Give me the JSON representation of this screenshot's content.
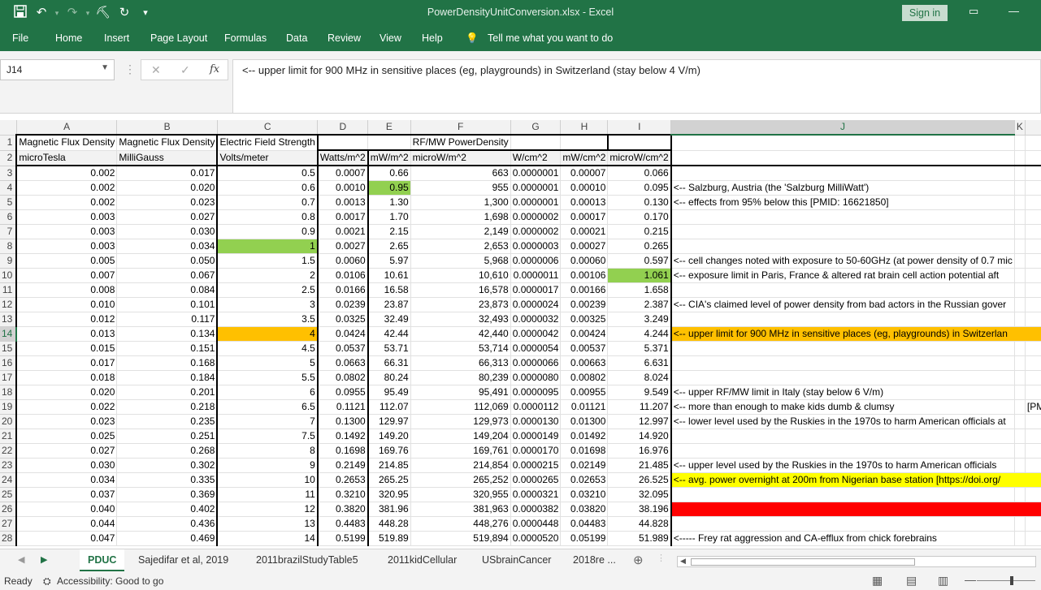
{
  "window": {
    "title": "PowerDensityUnitConversion.xlsx  -  Excel",
    "sign_in": "Sign in"
  },
  "ribbon": {
    "tabs": [
      "File",
      "Home",
      "Insert",
      "Page Layout",
      "Formulas",
      "Data",
      "Review",
      "View",
      "Help"
    ],
    "tell_me": "Tell me what you want to do"
  },
  "formula_bar": {
    "name_box": "J14",
    "formula": "<-- upper limit for 900 MHz in sensitive places (eg, playgrounds) in Switzerland (stay below 4 V/m)"
  },
  "columns": [
    "A",
    "B",
    "C",
    "D",
    "E",
    "F",
    "G",
    "H",
    "I",
    "J",
    "K",
    "L",
    "M",
    "N"
  ],
  "colors": {
    "excel_green": "#217346",
    "highlight_green": "#92d050",
    "highlight_orange": "#ffc000",
    "highlight_yellow": "#ffff00",
    "highlight_red": "#ff0000"
  },
  "rows": [
    {
      "n": "1",
      "cells": [
        "Magnetic Flux Density",
        "Magnetic Flux Density",
        "Electric Field Strength",
        "",
        "",
        "RF/MW PowerDensity",
        "",
        "",
        "",
        "",
        "",
        "",
        "",
        ""
      ]
    },
    {
      "n": "2",
      "cells": [
        "microTesla",
        "MilliGauss",
        "Volts/meter",
        "Watts/m^2",
        "mW/m^2",
        "microW/m^2",
        "W/cm^2",
        "mW/cm^2",
        "microW/cm^2",
        "",
        "",
        "",
        "",
        ""
      ]
    },
    {
      "n": "3",
      "cells": [
        "0.002",
        "0.017",
        "0.5",
        "0.0007",
        "0.66",
        "663",
        "0.0000001",
        "0.00007",
        "0.066",
        "",
        "",
        "",
        "",
        ""
      ]
    },
    {
      "n": "4",
      "cells": [
        "0.002",
        "0.020",
        "0.6",
        "0.0010",
        "0.95",
        "955",
        "0.0000001",
        "0.00010",
        "0.095",
        "<-- Salzburg, Austria (the 'Salzburg MilliWatt')",
        "",
        "",
        "",
        ""
      ]
    },
    {
      "n": "5",
      "cells": [
        "0.002",
        "0.023",
        "0.7",
        "0.0013",
        "1.30",
        "1,300",
        "0.0000001",
        "0.00013",
        "0.130",
        "<-- effects from 95% below this    [PMID: 16621850]",
        "",
        "",
        "",
        ""
      ]
    },
    {
      "n": "6",
      "cells": [
        "0.003",
        "0.027",
        "0.8",
        "0.0017",
        "1.70",
        "1,698",
        "0.0000002",
        "0.00017",
        "0.170",
        "",
        "",
        "",
        "",
        ""
      ]
    },
    {
      "n": "7",
      "cells": [
        "0.003",
        "0.030",
        "0.9",
        "0.0021",
        "2.15",
        "2,149",
        "0.0000002",
        "0.00021",
        "0.215",
        "",
        "",
        "",
        "",
        ""
      ]
    },
    {
      "n": "8",
      "cells": [
        "0.003",
        "0.034",
        "1",
        "0.0027",
        "2.65",
        "2,653",
        "0.0000003",
        "0.00027",
        "0.265",
        "",
        "",
        "",
        "",
        ""
      ]
    },
    {
      "n": "9",
      "cells": [
        "0.005",
        "0.050",
        "1.5",
        "0.0060",
        "5.97",
        "5,968",
        "0.0000006",
        "0.00060",
        "0.597",
        "<-- cell changes noted with exposure to 50-60GHz (at power density of 0.7 mic",
        "",
        "",
        "",
        ""
      ]
    },
    {
      "n": "10",
      "cells": [
        "0.007",
        "0.067",
        "2",
        "0.0106",
        "10.61",
        "10,610",
        "0.0000011",
        "0.00106",
        "1.061",
        "<-- exposure limit in Paris, France & altered rat brain cell action potential aft",
        "",
        "",
        "",
        ""
      ]
    },
    {
      "n": "11",
      "cells": [
        "0.008",
        "0.084",
        "2.5",
        "0.0166",
        "16.58",
        "16,578",
        "0.0000017",
        "0.00166",
        "1.658",
        "",
        "",
        "",
        "",
        ""
      ]
    },
    {
      "n": "12",
      "cells": [
        "0.010",
        "0.101",
        "3",
        "0.0239",
        "23.87",
        "23,873",
        "0.0000024",
        "0.00239",
        "2.387",
        "<-- CIA's claimed level of power density from bad actors in the Russian gover",
        "",
        "",
        "",
        ""
      ]
    },
    {
      "n": "13",
      "cells": [
        "0.012",
        "0.117",
        "3.5",
        "0.0325",
        "32.49",
        "32,493",
        "0.0000032",
        "0.00325",
        "3.249",
        "",
        "",
        "",
        "",
        ""
      ]
    },
    {
      "n": "14",
      "cells": [
        "0.013",
        "0.134",
        "4",
        "0.0424",
        "42.44",
        "42,440",
        "0.0000042",
        "0.00424",
        "4.244",
        "<-- upper limit for 900 MHz in sensitive places (eg, playgrounds) in Switzerlan",
        "",
        "",
        "",
        ""
      ]
    },
    {
      "n": "15",
      "cells": [
        "0.015",
        "0.151",
        "4.5",
        "0.0537",
        "53.71",
        "53,714",
        "0.0000054",
        "0.00537",
        "5.371",
        "",
        "",
        "",
        "",
        ""
      ]
    },
    {
      "n": "16",
      "cells": [
        "0.017",
        "0.168",
        "5",
        "0.0663",
        "66.31",
        "66,313",
        "0.0000066",
        "0.00663",
        "6.631",
        "",
        "",
        "",
        "",
        ""
      ]
    },
    {
      "n": "17",
      "cells": [
        "0.018",
        "0.184",
        "5.5",
        "0.0802",
        "80.24",
        "80,239",
        "0.0000080",
        "0.00802",
        "8.024",
        "",
        "",
        "",
        "",
        ""
      ]
    },
    {
      "n": "18",
      "cells": [
        "0.020",
        "0.201",
        "6",
        "0.0955",
        "95.49",
        "95,491",
        "0.0000095",
        "0.00955",
        "9.549",
        "<-- upper RF/MW limit in Italy (stay below 6 V/m)",
        "",
        "",
        "",
        ""
      ]
    },
    {
      "n": "19",
      "cells": [
        "0.022",
        "0.218",
        "6.5",
        "0.1121",
        "112.07",
        "112,069",
        "0.0000112",
        "0.01121",
        "11.207",
        "<-- more than enough to make kids dumb & clumsy",
        "",
        "[PMID: 305262",
        "",
        ""
      ]
    },
    {
      "n": "20",
      "cells": [
        "0.023",
        "0.235",
        "7",
        "0.1300",
        "129.97",
        "129,973",
        "0.0000130",
        "0.01300",
        "12.997",
        "<-- lower level used by the Ruskies in the 1970s to harm American officials at",
        "",
        "",
        "",
        ""
      ]
    },
    {
      "n": "21",
      "cells": [
        "0.025",
        "0.251",
        "7.5",
        "0.1492",
        "149.20",
        "149,204",
        "0.0000149",
        "0.01492",
        "14.920",
        "",
        "",
        "",
        "",
        ""
      ]
    },
    {
      "n": "22",
      "cells": [
        "0.027",
        "0.268",
        "8",
        "0.1698",
        "169.76",
        "169,761",
        "0.0000170",
        "0.01698",
        "16.976",
        "",
        "",
        "",
        "",
        ""
      ]
    },
    {
      "n": "23",
      "cells": [
        "0.030",
        "0.302",
        "9",
        "0.2149",
        "214.85",
        "214,854",
        "0.0000215",
        "0.02149",
        "21.485",
        "<-- upper level used by the Ruskies in the 1970s to harm American officials",
        "",
        "",
        "",
        ""
      ]
    },
    {
      "n": "24",
      "cells": [
        "0.034",
        "0.335",
        "10",
        "0.2653",
        "265.25",
        "265,252",
        "0.0000265",
        "0.02653",
        "26.525",
        "<-- avg. power overnight at 200m from Nigerian base station [https://doi.org/",
        "",
        "",
        "",
        ""
      ]
    },
    {
      "n": "25",
      "cells": [
        "0.037",
        "0.369",
        "11",
        "0.3210",
        "320.95",
        "320,955",
        "0.0000321",
        "0.03210",
        "32.095",
        "",
        "",
        "",
        "",
        ""
      ]
    },
    {
      "n": "26",
      "cells": [
        "0.040",
        "0.402",
        "12",
        "0.3820",
        "381.96",
        "381,963",
        "0.0000382",
        "0.03820",
        "38.196",
        "<-- more than enough average power for 35% increase in cancer death rate",
        "",
        "",
        "",
        ""
      ]
    },
    {
      "n": "27",
      "cells": [
        "0.044",
        "0.436",
        "13",
        "0.4483",
        "448.28",
        "448,276",
        "0.0000448",
        "0.04483",
        "44.828",
        "",
        "",
        "",
        "",
        ""
      ]
    },
    {
      "n": "28",
      "cells": [
        "0.047",
        "0.469",
        "14",
        "0.5199",
        "519.89",
        "519,894",
        "0.0000520",
        "0.05199",
        "51.989",
        "<-----         Frey rat aggression and CA-efflux from chick forebrains",
        "",
        "",
        "",
        ""
      ]
    }
  ],
  "sheet_tabs": [
    "PDUC",
    "Sajedifar et al, 2019",
    "2011brazilStudyTable5",
    "2011kidCellular",
    "USbrainCancer",
    "2018re ..."
  ],
  "status": {
    "ready": "Ready",
    "accessibility": "Accessibility: Good to go"
  }
}
